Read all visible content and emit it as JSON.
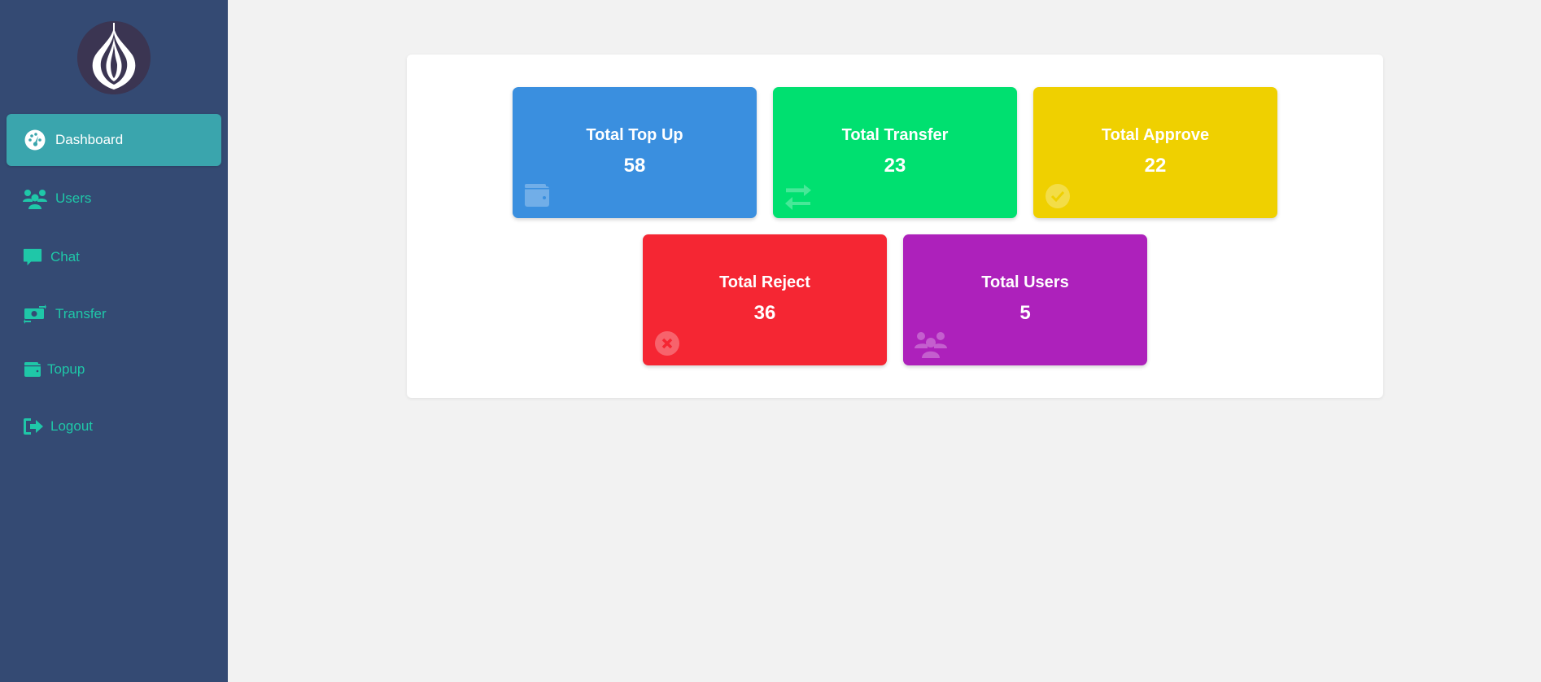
{
  "sidebar": {
    "logo_icon": "onion-logo",
    "items": [
      {
        "label": "Dashboard",
        "icon": "dashboard-icon",
        "active": true
      },
      {
        "label": "Users",
        "icon": "users-icon",
        "active": false
      },
      {
        "label": "Chat",
        "icon": "chat-icon",
        "active": false
      },
      {
        "label": "Transfer",
        "icon": "money-transfer-icon",
        "active": false
      },
      {
        "label": "Topup",
        "icon": "wallet-icon",
        "active": false
      },
      {
        "label": "Logout",
        "icon": "logout-icon",
        "active": false
      }
    ]
  },
  "cards": [
    {
      "title": "Total Top Up",
      "value": "58",
      "color": "#3a8fdf",
      "icon": "wallet-icon"
    },
    {
      "title": "Total Transfer",
      "value": "23",
      "color": "#00e070",
      "icon": "exchange-icon"
    },
    {
      "title": "Total Approve",
      "value": "22",
      "color": "#efd000",
      "icon": "check-circle-icon"
    },
    {
      "title": "Total Reject",
      "value": "36",
      "color": "#f52633",
      "icon": "times-circle-icon"
    },
    {
      "title": "Total Users",
      "value": "5",
      "color": "#ad21bb",
      "icon": "users-icon"
    }
  ],
  "colors": {
    "sidebar_bg": "#344a73",
    "sidebar_active": "#3aa5ad",
    "sidebar_text": "#1fc7a8",
    "page_bg": "#f2f2f2"
  }
}
